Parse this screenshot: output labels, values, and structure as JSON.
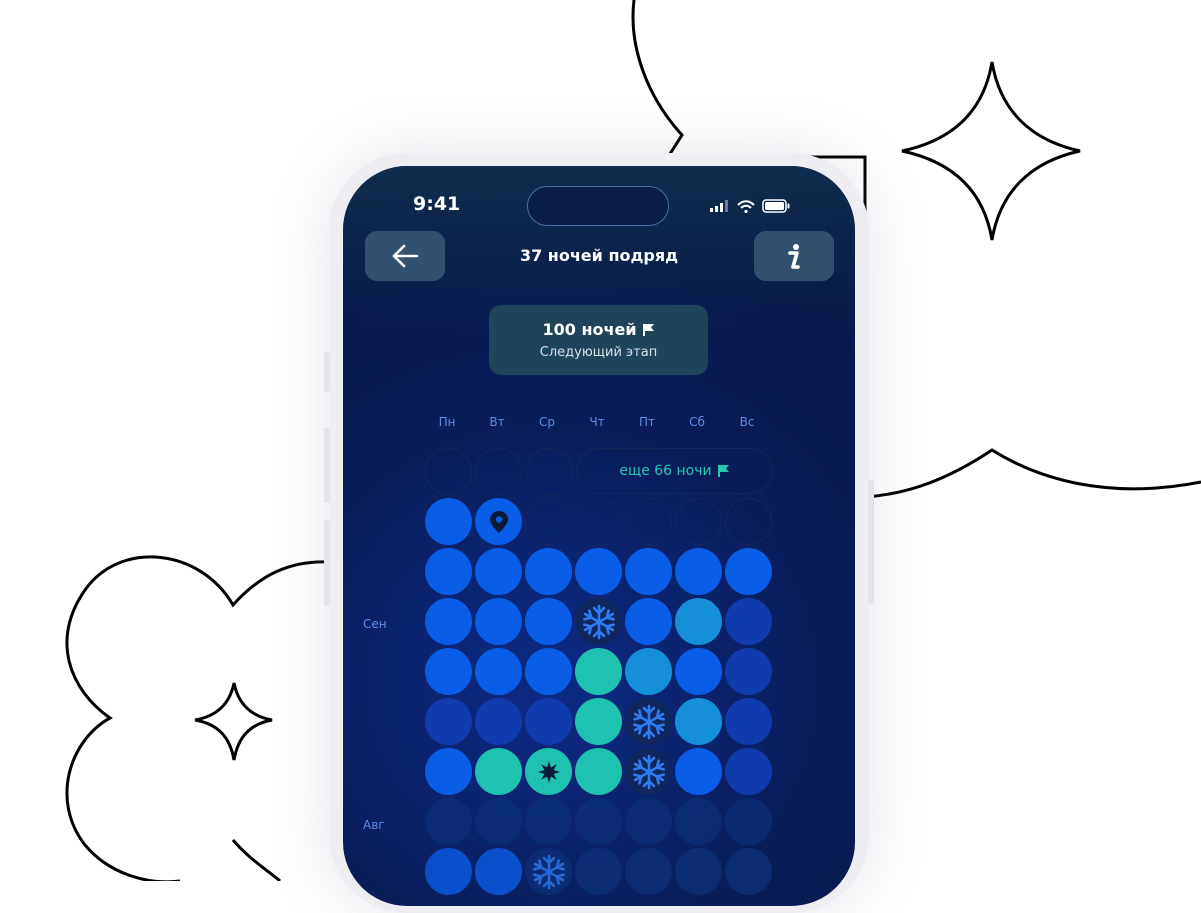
{
  "status": {
    "time": "9:41"
  },
  "header": {
    "title": "37 ночей подряд",
    "back_icon": "arrow-left-icon",
    "info_icon": "info-icon"
  },
  "milestone": {
    "title": "100 ночей",
    "subtitle": "Следующий этап",
    "icon": "flag-icon"
  },
  "weekdays": [
    "Пн",
    "Вт",
    "Ср",
    "Чт",
    "Пт",
    "Сб",
    "Вс"
  ],
  "remaining": {
    "text": "еще 66 ночи",
    "icon": "flag-icon"
  },
  "months": [
    "Сен",
    "Авг"
  ],
  "colors": {
    "blue": "#0a5de6",
    "dark_blue": "#0f3bad",
    "teal": "#1fc1b0",
    "cyan": "#1590d8",
    "freeze": "#10265f",
    "faded": "#0c2f78"
  },
  "calendar_rows": [
    [
      "empty",
      "empty",
      "empty",
      "remaining",
      "remaining",
      "remaining",
      "remaining"
    ],
    [
      "blue",
      "pin",
      "empty",
      "empty",
      "empty",
      "empty",
      "empty"
    ],
    [
      "blue",
      "blue",
      "blue",
      "blue",
      "blue",
      "blue",
      "blue"
    ],
    [
      "blue",
      "blue",
      "blue",
      "freeze",
      "blue",
      "cyan",
      "dark_blue"
    ],
    [
      "blue",
      "blue",
      "blue",
      "teal",
      "cyan",
      "blue",
      "dark_blue"
    ],
    [
      "dark_blue",
      "dark_blue",
      "dark_blue",
      "teal",
      "freeze",
      "cyan",
      "dark_blue"
    ],
    [
      "blue",
      "teal",
      "star",
      "teal",
      "freeze",
      "blue",
      "dark_blue"
    ],
    [
      "faded",
      "faded",
      "faded",
      "faded",
      "faded",
      "faded",
      "faded"
    ],
    [
      "blue",
      "blue",
      "freeze_faded",
      "faded",
      "faded",
      "faded",
      "faded"
    ]
  ]
}
